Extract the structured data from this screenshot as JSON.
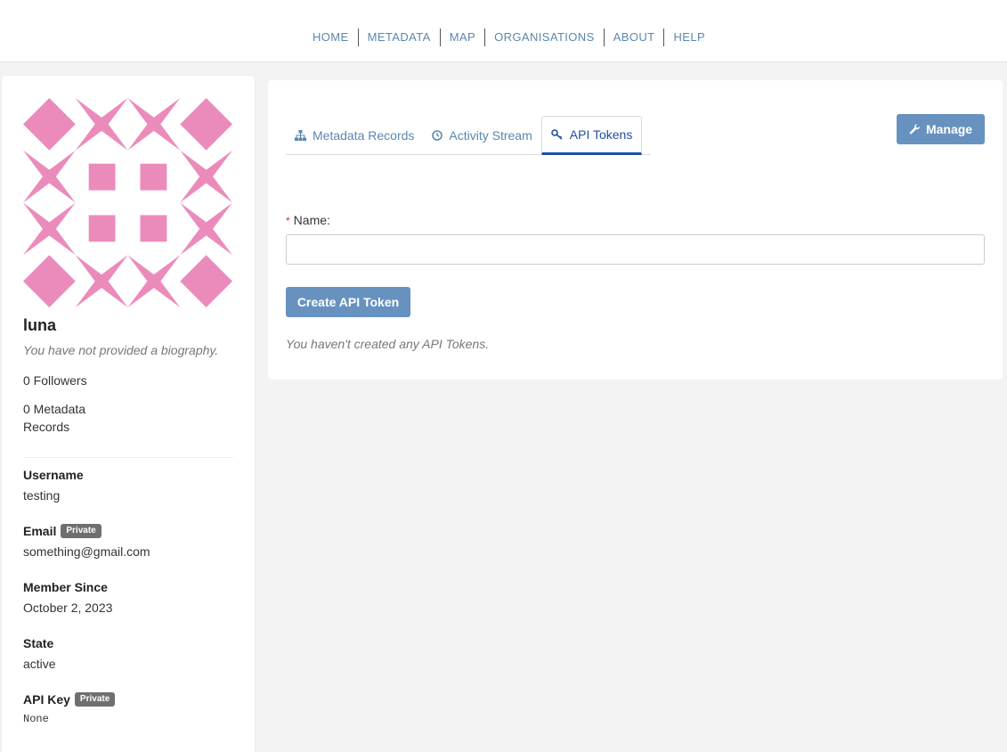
{
  "nav": {
    "items": [
      "HOME",
      "METADATA",
      "MAP",
      "ORGANISATIONS",
      "ABOUT",
      "HELP"
    ]
  },
  "colors": {
    "accent": "#6792c0",
    "link": "#5b87b0",
    "active_tab": "#1f50a8",
    "avatar": "#eb8bbc"
  },
  "profile": {
    "name": "luna",
    "bio": "You have not provided a biography.",
    "followers": "0 Followers",
    "metadata_records": "0 Metadata Records",
    "fields": [
      {
        "label": "Username",
        "value": "testing",
        "badge": ""
      },
      {
        "label": "Email",
        "value": "something@gmail.com",
        "badge": "Private"
      },
      {
        "label": "Member Since",
        "value": "October 2, 2023",
        "badge": ""
      },
      {
        "label": "State",
        "value": "active",
        "badge": ""
      },
      {
        "label": "API Key",
        "value": "None",
        "badge": "Private"
      }
    ]
  },
  "tabs": [
    {
      "label": "Metadata Records",
      "icon": "sitemap-icon",
      "active": false
    },
    {
      "label": "Activity Stream",
      "icon": "clock-icon",
      "active": false
    },
    {
      "label": "API Tokens",
      "icon": "key-icon",
      "active": true
    }
  ],
  "manage_button": {
    "label": "Manage",
    "icon": "wrench-icon"
  },
  "form": {
    "required_mark": "*",
    "name_label": "Name:",
    "name_value": "",
    "name_placeholder": "",
    "submit_label": "Create API Token"
  },
  "empty_message": "You haven't created any API Tokens."
}
